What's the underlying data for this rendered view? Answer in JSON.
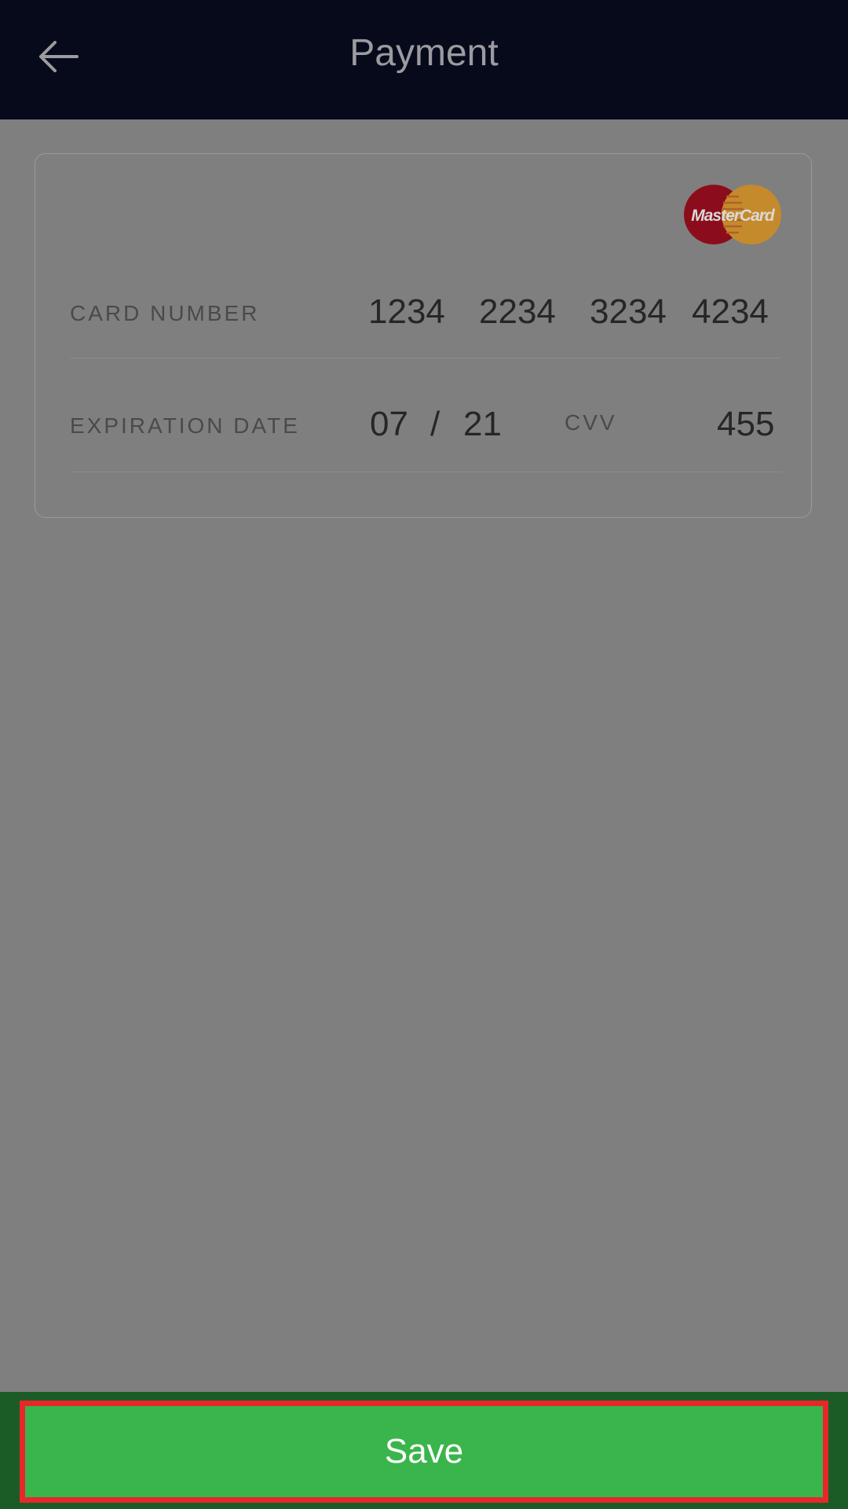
{
  "header": {
    "title": "Payment",
    "back_icon": "arrow-left-icon"
  },
  "card": {
    "brand": "MasterCard",
    "brand_colors": [
      "#8b0d1b",
      "#c58a2b"
    ],
    "card_number_label": "CARD NUMBER",
    "card_number_groups": [
      "1234",
      "2234",
      "3234",
      "4234"
    ],
    "expiration_label": "EXPIRATION DATE",
    "expiration_month": "07",
    "expiration_separator": "/",
    "expiration_year": "21",
    "cvv_label": "CVV",
    "cvv_value": "455"
  },
  "footer": {
    "save_label": "Save"
  },
  "colors": {
    "header_bg": "#060a1b",
    "overlay": "#7f7f7f",
    "save_button": "#3ab54b",
    "save_button_border": "#e8272b"
  }
}
